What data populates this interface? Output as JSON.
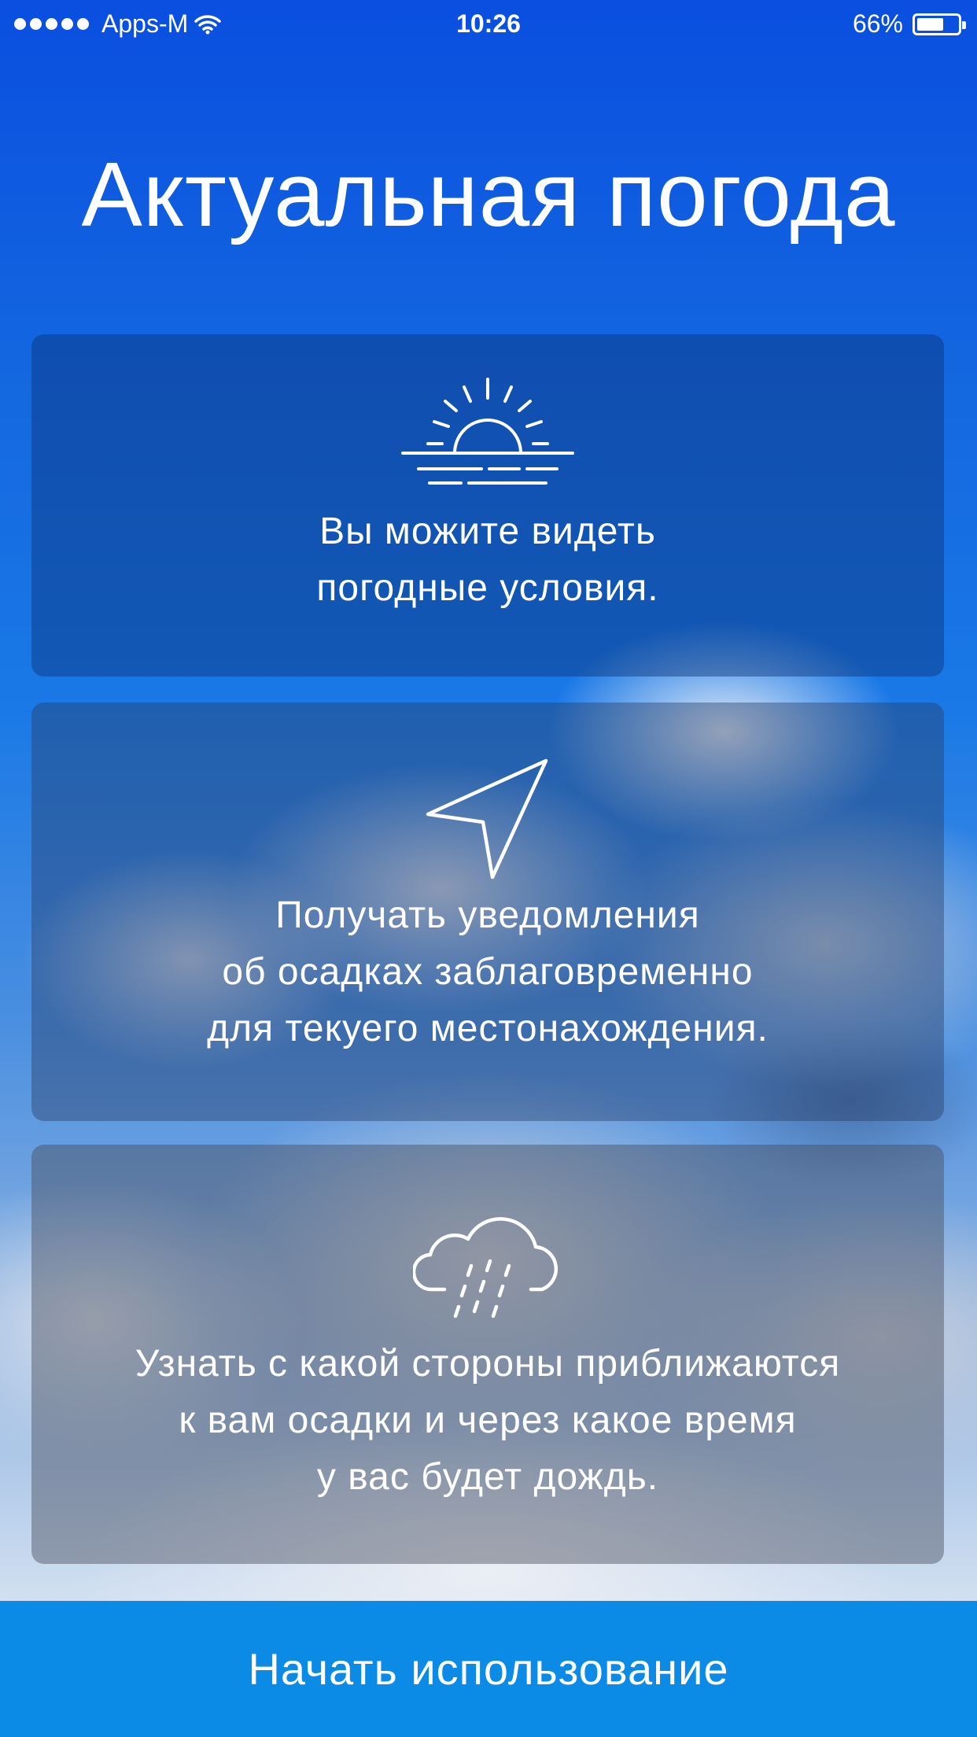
{
  "status_bar": {
    "carrier": "Apps-M",
    "time": "10:26",
    "battery_percent": "66%",
    "battery_level": 0.66,
    "signal_bars": 5
  },
  "title": "Актуальная погода",
  "cards": [
    {
      "icon": "sunrise-icon",
      "lines": [
        "Вы можите видеть",
        "погодные условия."
      ]
    },
    {
      "icon": "location-arrow-icon",
      "lines": [
        "Получать уведомления",
        "об осадках заблаговременно",
        "для текуего местонахождения."
      ]
    },
    {
      "icon": "rain-cloud-icon",
      "lines": [
        "Узнать с какой стороны приближаются",
        "к вам осадки и через какое время",
        "у вас будет дождь."
      ]
    }
  ],
  "cta": {
    "label": "Начать использование",
    "color": "#0b8be6"
  }
}
